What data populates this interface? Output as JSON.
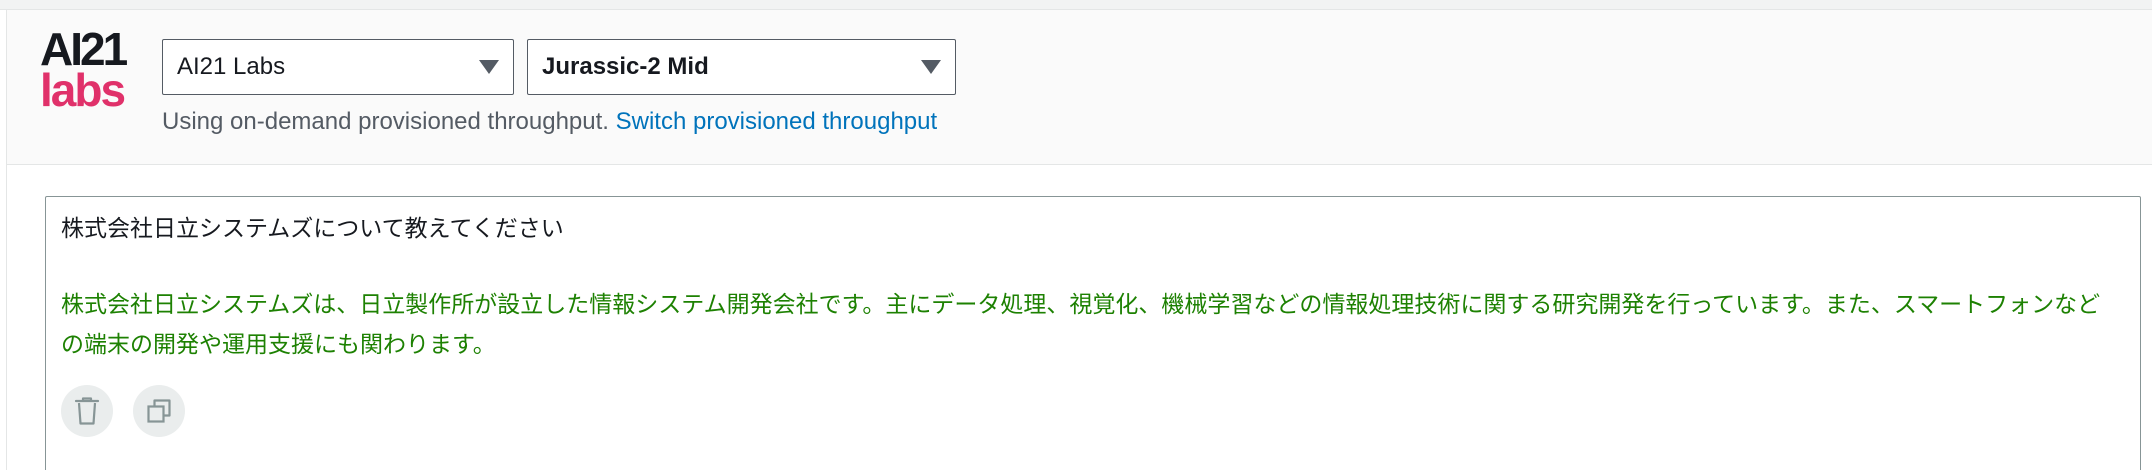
{
  "logo": {
    "top_text": "AI21",
    "bottom_text": "labs"
  },
  "model_selector": {
    "provider": "AI21 Labs",
    "model": "Jurassic-2 Mid"
  },
  "throughput": {
    "status_text": "Using on-demand provisioned throughput.",
    "switch_link": "Switch provisioned throughput"
  },
  "chat": {
    "prompt": "株式会社日立システムズについて教えてください",
    "response": "株式会社日立システムズは、日立製作所が設立した情報システム開発会社です。主にデータ処理、視覚化、機械学習などの情報処理技術に関する研究開発を行っています。また、スマートフォンなどの端末の開発や運用支援にも関わります。"
  },
  "icons": {
    "delete": "trash-icon",
    "copy": "copy-icon",
    "dropdown": "caret-down-icon"
  },
  "colors": {
    "response_text": "#1d8102",
    "link": "#0073bb",
    "logo_accent": "#e0316a",
    "logo_dark": "#16191f"
  }
}
